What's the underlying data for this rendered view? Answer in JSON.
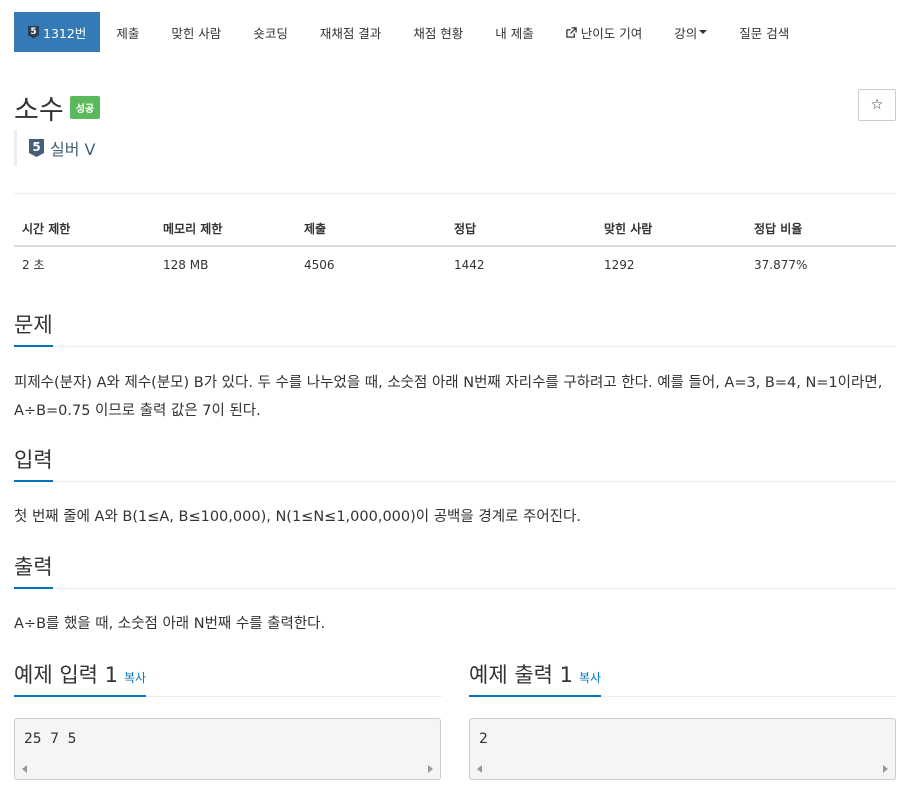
{
  "nav": {
    "problem_tab": {
      "tier": "5",
      "label": "1312번"
    },
    "items": [
      "제출",
      "맞힌 사람",
      "숏코딩",
      "재채점 결과",
      "채점 현황",
      "내 제출",
      "난이도 기여",
      "강의",
      "질문 검색"
    ]
  },
  "problem": {
    "title": "소수",
    "status_label": "성공",
    "tier_number": "5",
    "tier_name": "실버 V",
    "star": "☆"
  },
  "stats": {
    "headers": [
      "시간 제한",
      "메모리 제한",
      "제출",
      "정답",
      "맞힌 사람",
      "정답 비율"
    ],
    "values": [
      "2 초",
      "128 MB",
      "4506",
      "1442",
      "1292",
      "37.877%"
    ]
  },
  "sections": {
    "description": {
      "title": "문제",
      "text": "피제수(분자) A와 제수(분모) B가 있다. 두 수를 나누었을 때, 소숫점 아래 N번째 자리수를 구하려고 한다. 예를 들어, A=3, B=4, N=1이라면, A÷B=0.75 이므로 출력 값은 7이 된다."
    },
    "input": {
      "title": "입력",
      "text": "첫 번째 줄에 A와 B(1≤A, B≤100,000), N(1≤N≤1,000,000)이 공백을 경계로 주어진다."
    },
    "output": {
      "title": "출력",
      "text": "A÷B를 했을 때, 소숫점 아래 N번째 수를 출력한다."
    },
    "sample_input": {
      "title": "예제 입력 1",
      "copy": "복사",
      "data": "25 7 5"
    },
    "sample_output": {
      "title": "예제 출력 1",
      "copy": "복사",
      "data": "2"
    }
  },
  "colors": {
    "primary": "#337ab7",
    "success": "#5cb85c",
    "tier_silver": "#435f7a",
    "link": "#0076c0"
  }
}
